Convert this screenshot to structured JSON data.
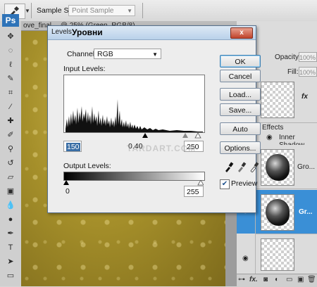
{
  "options_bar": {
    "sample_size_label": "Sample Size:",
    "sample_size_value": "Point Sample"
  },
  "document": {
    "tab_title": "ove_final… @ 25% (Green, RGB/8)"
  },
  "layers_panel": {
    "opacity_label": "Opacity:",
    "opacity_value": "100%",
    "fill_label": "Fill:",
    "fill_value": "100%",
    "effects_label": "Effects",
    "inner_shadow_label": "Inner Shadow",
    "layer_gro_label": "Gro...",
    "layer_gr_label": "Gr...",
    "fx_label": "fx"
  },
  "levels_dialog": {
    "title": "Levels",
    "title_ru": "Уровни",
    "close_label": "x",
    "channel_label": "Channel:",
    "channel_value": "RGB",
    "input_levels_label": "Input Levels:",
    "input_black": "150",
    "input_gamma": "0.40",
    "input_white": "250",
    "output_levels_label": "Output Levels:",
    "output_black": "0",
    "output_white": "255",
    "watermark": "TARDART.COM",
    "buttons": {
      "ok": "OK",
      "cancel": "Cancel",
      "load": "Load...",
      "save": "Save...",
      "auto": "Auto",
      "options": "Options..."
    },
    "preview_label": "Preview",
    "preview_checked": true
  }
}
